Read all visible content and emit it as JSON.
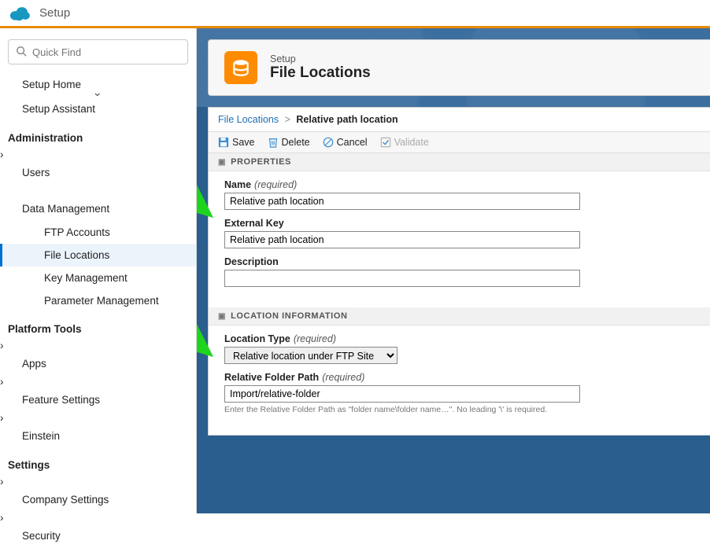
{
  "topbar": {
    "title": "Setup"
  },
  "quickfind": {
    "placeholder": "Quick Find"
  },
  "nav": {
    "home": "Setup Home",
    "assistant": "Setup Assistant",
    "sections": {
      "admin": {
        "label": "Administration",
        "users": "Users",
        "data_mgmt": {
          "label": "Data Management",
          "ftp": "FTP Accounts",
          "file_locations": "File Locations",
          "key_mgmt": "Key Management",
          "param_mgmt": "Parameter Management"
        }
      },
      "platform": {
        "label": "Platform Tools",
        "apps": "Apps",
        "feature_settings": "Feature Settings",
        "einstein": "Einstein"
      },
      "settings": {
        "label": "Settings",
        "company": "Company Settings",
        "security": "Security"
      }
    }
  },
  "hero": {
    "sup": "Setup",
    "title": "File Locations"
  },
  "breadcrumb": {
    "root": "File Locations",
    "current": "Relative path location"
  },
  "toolbar": {
    "save": "Save",
    "delete": "Delete",
    "cancel": "Cancel",
    "validate": "Validate"
  },
  "sections": {
    "properties": "Properties",
    "location_info": "Location Information"
  },
  "fields": {
    "name": {
      "label": "Name",
      "required": "(required)",
      "value": "Relative path location"
    },
    "external_key": {
      "label": "External Key",
      "value": "Relative path location"
    },
    "description": {
      "label": "Description",
      "value": ""
    },
    "location_type": {
      "label": "Location Type",
      "required": "(required)",
      "value": "Relative location under FTP Site"
    },
    "folder_path": {
      "label": "Relative Folder Path",
      "required": "(required)",
      "value": "Import/relative-folder",
      "hint": "Enter the Relative Folder Path as \"folder name\\folder name…\". No leading '\\' is required."
    }
  }
}
